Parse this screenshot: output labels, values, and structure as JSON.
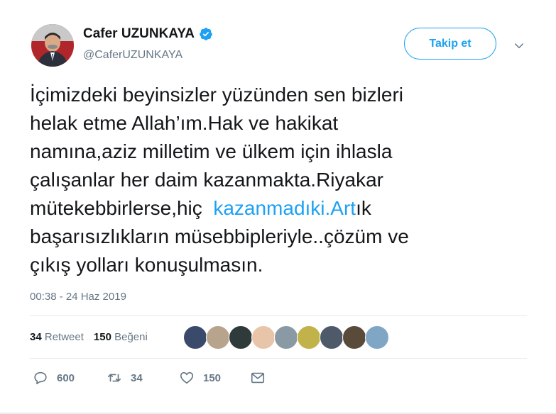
{
  "author": {
    "name": "Cafer UZUNKAYA",
    "handle": "@CaferUZUNKAYA",
    "verified": true
  },
  "follow_button": "Takip et",
  "tweet": {
    "lines": [
      "İçimizdeki beyinsizler yüzünden sen bizleri",
      "helak etme Allah’ım.Hak ve hakikat",
      "namına,aziz milletim ve ülkem için ihlasla",
      "çalışanlar her daim kazanmakta.Riyakar"
    ],
    "line5_prefix": "mütekebbirlerse,hiç  ",
    "line5_link": "kazanmadıki.Art",
    "line5_suffix": "ık",
    "lines_after": [
      "başarısızlıkların müsebbipleriyle..çözüm ve",
      "çıkış yolları konuşulmasın."
    ]
  },
  "timestamp": "00:38 - 24 Haz 2019",
  "stats": {
    "retweets_count": "34",
    "retweets_label": "Retweet",
    "likes_count": "150",
    "likes_label": "Beğeni"
  },
  "likers": [
    {
      "color": "#3a4a6b"
    },
    {
      "color": "#b8a48c"
    },
    {
      "color": "#2f3a3a"
    },
    {
      "color": "#e8c4a8"
    },
    {
      "color": "#8a9aa5"
    },
    {
      "color": "#c2b24a"
    },
    {
      "color": "#4e5a6a"
    },
    {
      "color": "#5a4a3a"
    },
    {
      "color": "#7fa6c4"
    }
  ],
  "actions": {
    "reply_count": "600",
    "retweet_count": "34",
    "like_count": "150"
  },
  "colors": {
    "accent": "#1da1f2",
    "text": "#14171a",
    "muted": "#657786"
  }
}
